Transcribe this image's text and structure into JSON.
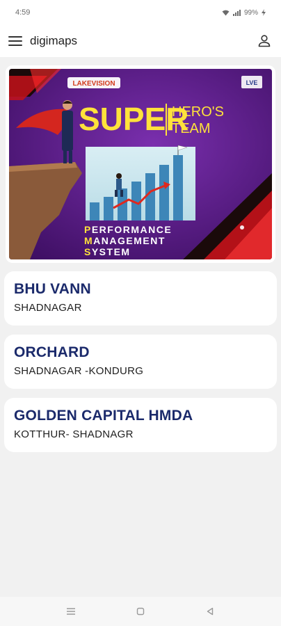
{
  "status_bar": {
    "time": "4:59",
    "battery": "99%"
  },
  "app_bar": {
    "title": "digimaps",
    "menu_icon": "hamburger-menu-icon",
    "profile_icon": "person-icon"
  },
  "banner": {
    "logo_text": "LAKEVISION",
    "corner_logo": "LVE",
    "headline": "SUPER",
    "subhead_line1": "HERO'S",
    "subhead_line2": "TEAM",
    "tag_line1": "ERFORMANCE",
    "tag_line2": "ANAGEMENT",
    "tag_line3": "YSTEM",
    "tag_initial1": "P",
    "tag_initial2": "M",
    "tag_initial3": "S"
  },
  "projects": [
    {
      "name": "BHU VANN",
      "location": "SHADNAGAR"
    },
    {
      "name": "ORCHARD",
      "location": "SHADNAGAR -KONDURG"
    },
    {
      "name": "GOLDEN CAPITAL HMDA",
      "location": "KOTTHUR- SHADNAGR"
    }
  ],
  "nav_bar": {
    "icons": [
      "recents-icon",
      "home-icon",
      "back-icon"
    ]
  },
  "colors": {
    "project_title": "#1b2a6b",
    "background": "#f1f1f1",
    "banner_purple": "#5a1f8c",
    "banner_yellow": "#ffe23b"
  }
}
